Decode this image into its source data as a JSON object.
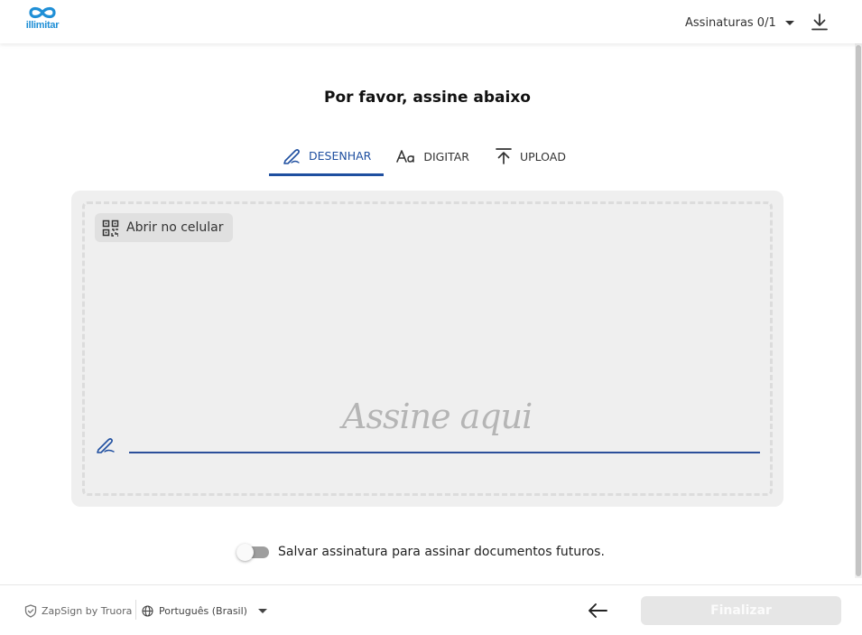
{
  "header": {
    "logo_text": "illimitar",
    "signatures_counter": "Assinaturas 0/1",
    "download_icon": "download-icon",
    "brand_color": "#1f8fd6"
  },
  "main": {
    "title": "Por favor, assine abaixo",
    "tabs": [
      {
        "label": "DESENHAR",
        "icon": "pen-icon",
        "active": true
      },
      {
        "label": "DIGITAR",
        "icon": "font-icon",
        "active": false
      },
      {
        "label": "UPLOAD",
        "icon": "upload-icon",
        "active": false
      }
    ],
    "open_mobile_label": "Abrir no celular",
    "signature_placeholder": "Assine aqui",
    "save_signature_label": "Salvar assinatura para assinar documentos futuros.",
    "save_signature_enabled": false,
    "accent_color": "#1f4fa0"
  },
  "footer": {
    "brand": "ZapSign by Truora",
    "language": "Português (Brasil)",
    "finish_label": "Finalizar"
  }
}
